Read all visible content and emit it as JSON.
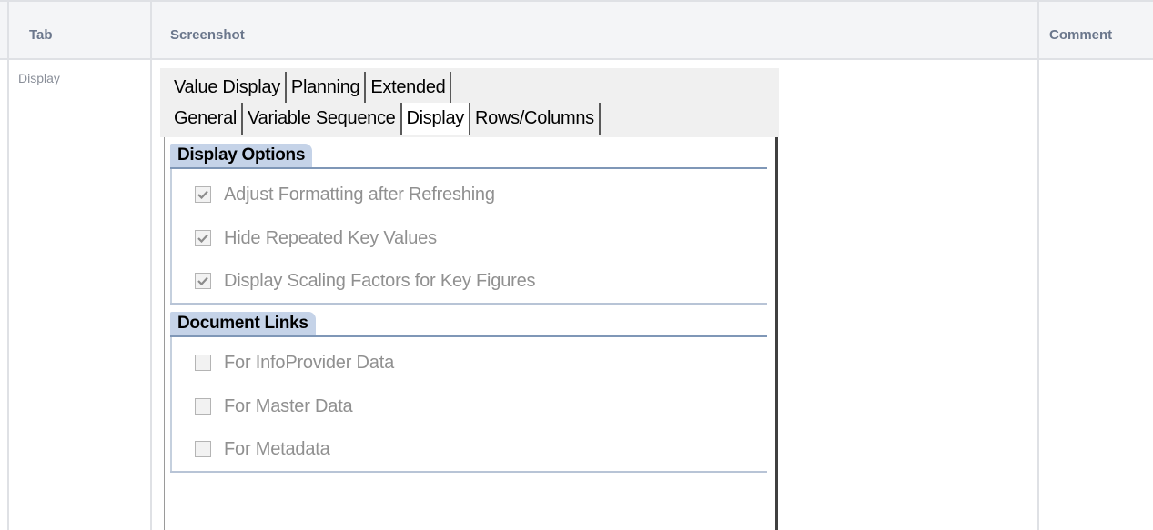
{
  "table": {
    "headers": {
      "tab": "Tab",
      "screenshot": "Screenshot",
      "comment": "Comment"
    },
    "row": {
      "tab": "Display",
      "comment": ""
    }
  },
  "dialog": {
    "tabs_row1": [
      "Value Display",
      "Planning",
      "Extended"
    ],
    "tabs_row2": [
      "General",
      "Variable Sequence",
      "Display",
      "Rows/Columns"
    ],
    "active_tab": "Display",
    "display_options": {
      "title": "Display Options",
      "options": [
        {
          "label": "Adjust Formatting after Refreshing",
          "checked": true
        },
        {
          "label": "Hide Repeated Key Values",
          "checked": true
        },
        {
          "label": "Display Scaling Factors for Key Figures",
          "checked": true
        }
      ]
    },
    "document_links": {
      "title": "Document Links",
      "options": [
        {
          "label": "For InfoProvider Data",
          "checked": false
        },
        {
          "label": "For Master Data",
          "checked": false
        },
        {
          "label": "For Metadata",
          "checked": false
        }
      ]
    }
  },
  "colors": {
    "header_bg": "#f4f5f7",
    "grid": "#dfe1e5",
    "group_title_bg": "#c5d3e8",
    "disabled_text": "#909090"
  },
  "icons": {
    "checked": "checkmark-icon"
  }
}
